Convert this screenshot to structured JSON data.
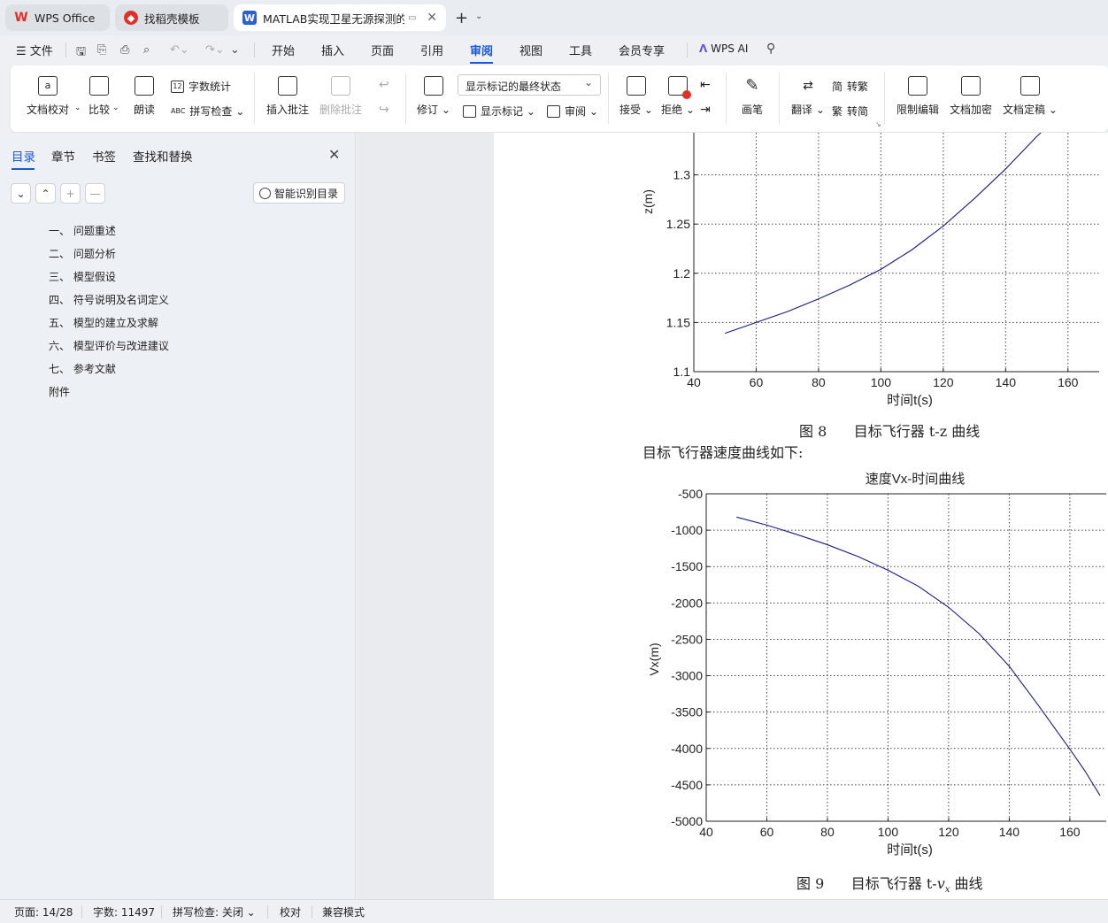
{
  "tabs": [
    {
      "label": "WPS Office",
      "icon": "wps-logo-icon"
    },
    {
      "label": "找稻壳模板",
      "icon": "docer-icon"
    },
    {
      "label": "MATLAB实现卫星无源探测的",
      "icon": "writer-icon"
    }
  ],
  "menu": {
    "file": "文件",
    "items": [
      "开始",
      "插入",
      "页面",
      "引用",
      "审阅",
      "视图",
      "工具",
      "会员专享"
    ],
    "active": "审阅",
    "wps_ai": "WPS AI"
  },
  "ribbon": {
    "proofread": "文档校对",
    "compare": "比较",
    "read_aloud": "朗读",
    "word_count": "字数统计",
    "spell_check": "拼写检查",
    "insert_comment": "插入批注",
    "delete_comment": "删除批注",
    "track_changes": "修订",
    "markup_state": "显示标记的最终状态",
    "show_markup": "显示标记",
    "review": "审阅",
    "accept": "接受",
    "reject": "拒绝",
    "pen": "画笔",
    "translate": "翻译",
    "to_traditional": "转繁",
    "to_simplified": "转简",
    "restrict_edit": "限制编辑",
    "encrypt": "文档加密",
    "finalize": "文档定稿"
  },
  "nav": {
    "tabs": [
      "目录",
      "章节",
      "书签",
      "查找和替换"
    ],
    "smart_toc": "智能识别目录",
    "toc": [
      "一、 问题重述",
      "二、 问题分析",
      "三、 模型假设",
      "四、 符号说明及名词定义",
      "五、 模型的建立及求解",
      "六、 模型评价与改进建议",
      "七、 参考文献",
      "附件"
    ]
  },
  "document": {
    "fig8_caption": "图 8      目标飞行器 t-z 曲线",
    "paragraph": "目标飞行器速度曲线如下:",
    "fig9_caption_prefix": "图 9      目标飞行器 t-",
    "fig9_caption_var": "v",
    "fig9_caption_sub": "x",
    "fig9_caption_suffix": " 曲线"
  },
  "chart_data": [
    {
      "type": "line",
      "title": "",
      "xlabel": "时间t(s)",
      "ylabel": "z(m)",
      "xlim": [
        40,
        170
      ],
      "ylim": [
        1.1,
        1.35
      ],
      "xticks": [
        40,
        60,
        80,
        100,
        120,
        140,
        160
      ],
      "yticks": [
        1.1,
        1.15,
        1.2,
        1.25,
        1.3
      ],
      "ytick_labels": [
        "1.1",
        "1.15",
        "1.2",
        "1.25",
        "1.3"
      ],
      "grid": true,
      "color": "#1a1a80",
      "x": [
        50,
        60,
        70,
        80,
        90,
        100,
        110,
        120,
        130,
        140,
        150,
        152
      ],
      "y": [
        1.139,
        1.15,
        1.161,
        1.174,
        1.188,
        1.204,
        1.224,
        1.248,
        1.276,
        1.306,
        1.339,
        1.345
      ]
    },
    {
      "type": "line",
      "title": "速度Vx-时间曲线",
      "xlabel": "时间t(s)",
      "ylabel": "Vx(m)",
      "xlim": [
        40,
        172
      ],
      "ylim": [
        -5000,
        -500
      ],
      "xticks": [
        40,
        60,
        80,
        100,
        120,
        140,
        160
      ],
      "yticks": [
        -5000,
        -4500,
        -4000,
        -3500,
        -3000,
        -2500,
        -2000,
        -1500,
        -1000,
        -500
      ],
      "grid": true,
      "color": "#1a1a80",
      "x": [
        50,
        60,
        70,
        80,
        90,
        100,
        110,
        120,
        130,
        140,
        150,
        160,
        165,
        170
      ],
      "y": [
        -820,
        -930,
        -1060,
        -1200,
        -1360,
        -1550,
        -1770,
        -2060,
        -2420,
        -2870,
        -3430,
        -4010,
        -4310,
        -4650
      ]
    }
  ],
  "status": {
    "page": "页面: 14/28",
    "words": "字数: 11497",
    "spell": "拼写检查: 关闭",
    "proof": "校对",
    "compat": "兼容模式"
  }
}
